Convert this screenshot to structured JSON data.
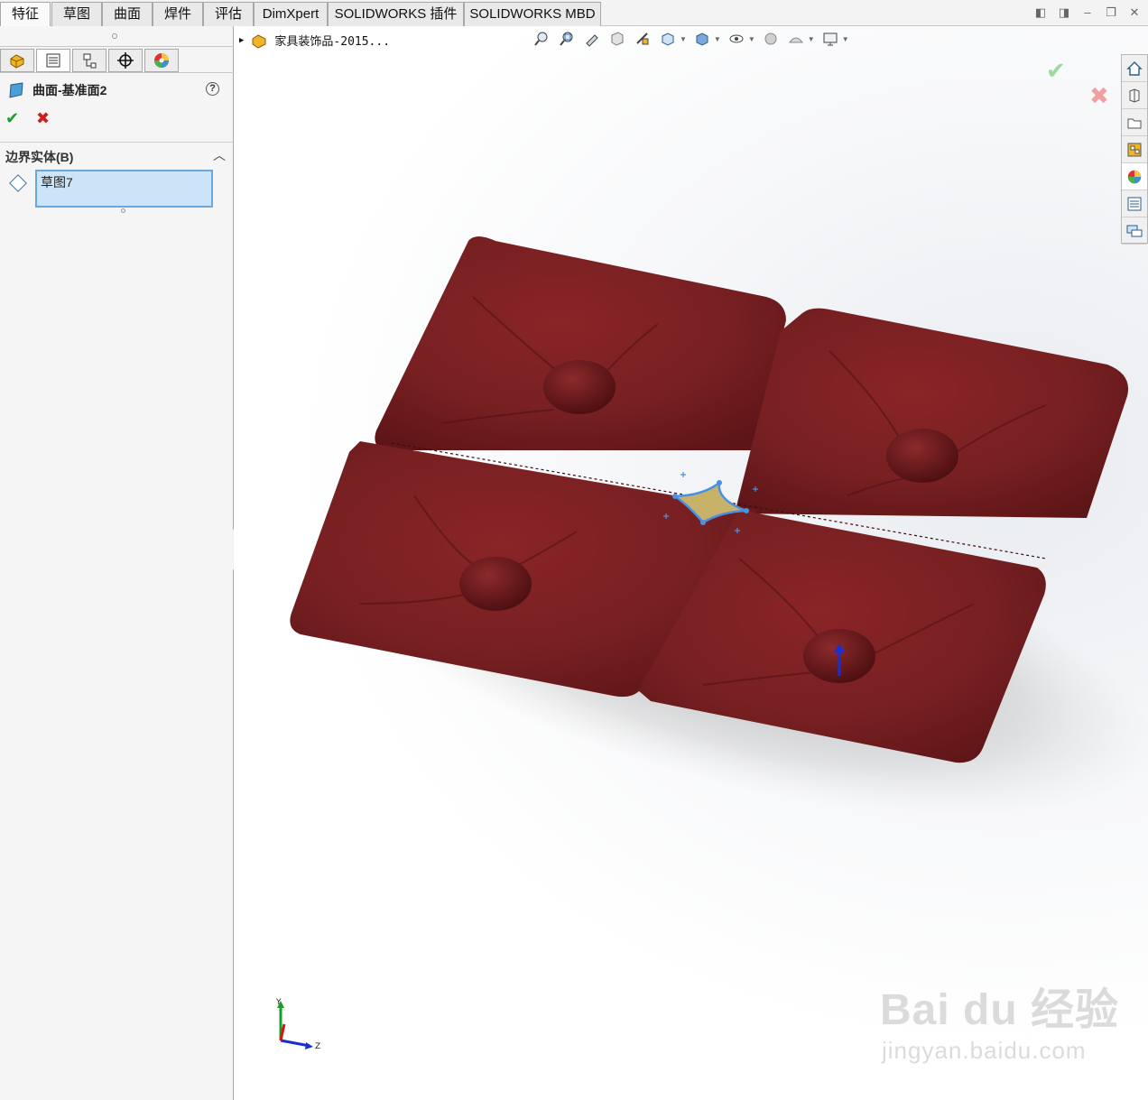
{
  "command_tabs": [
    "特征",
    "草图",
    "曲面",
    "焊件",
    "评估",
    "DimXpert",
    "SOLIDWORKS 插件",
    "SOLIDWORKS MBD"
  ],
  "window_controls": [
    "restore-left",
    "restore-right",
    "minimize",
    "maximize",
    "close"
  ],
  "property_manager": {
    "tabs": [
      "feature-manager-icon",
      "property-manager-icon",
      "configuration-manager-icon",
      "dimxpert-manager-icon",
      "display-manager-icon"
    ],
    "title": "曲面-基准面2",
    "help": "?",
    "ok": "✔",
    "cancel": "✖",
    "section": {
      "label": "边界实体(B)",
      "selection": "草图7"
    }
  },
  "graphics": {
    "breadcrumb": "家具装饰品-2015...",
    "heads_up_toolbar": [
      "zoom-to-fit-icon",
      "zoom-to-area-icon",
      "previous-view-icon",
      "section-view-icon",
      "dynamic-annotation-icon",
      "view-orientation-icon",
      "display-style-icon",
      "hide-show-icon",
      "edit-appearance-icon",
      "apply-scene-icon",
      "view-settings-icon"
    ],
    "task_pane": [
      "home-icon",
      "parts-library-icon",
      "file-explorer-icon",
      "view-palette-icon",
      "appearances-icon",
      "custom-properties-icon",
      "forum-icon"
    ],
    "triad_labels": {
      "y": "Y",
      "z": "Z"
    },
    "colors": {
      "surface": "#7a1c1f",
      "boundary_patch": "#c8b26a",
      "sketch": "#4a90e2"
    }
  },
  "watermark": {
    "logo": "Bai du 经验",
    "url": "jingyan.baidu.com"
  }
}
